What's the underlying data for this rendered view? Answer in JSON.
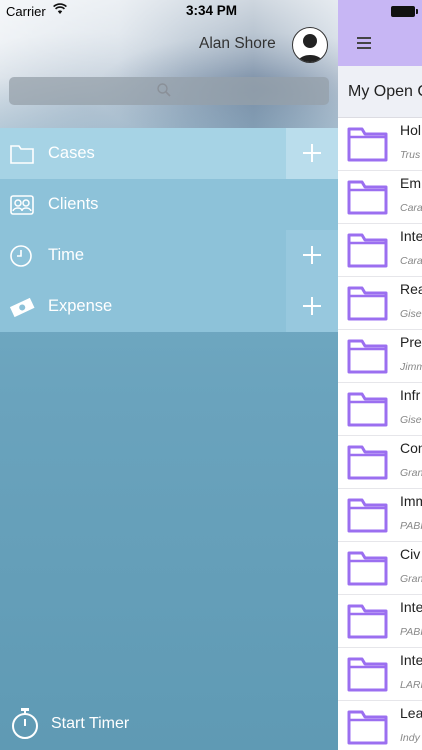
{
  "status_bar": {
    "carrier": "Carrier",
    "time": "3:34 PM"
  },
  "user": {
    "name": "Alan Shore"
  },
  "search": {
    "placeholder": ""
  },
  "menu": {
    "items": [
      {
        "label": "Cases",
        "icon": "folder-icon",
        "has_add": true,
        "active": true
      },
      {
        "label": "Clients",
        "icon": "contacts-icon",
        "has_add": false
      },
      {
        "label": "Time",
        "icon": "clock-icon",
        "has_add": true
      },
      {
        "label": "Expense",
        "icon": "money-icon",
        "has_add": true
      }
    ]
  },
  "footer": {
    "start_timer_label": "Start Timer"
  },
  "main": {
    "section_title": "My Open C",
    "cases": [
      {
        "title": "Hol",
        "sub": "Trus"
      },
      {
        "title": "Em",
        "sub": "Cara"
      },
      {
        "title": "Inte",
        "sub": "Cara"
      },
      {
        "title": "Rea",
        "sub": "Gise"
      },
      {
        "title": "Pre",
        "sub": "Jimm"
      },
      {
        "title": "Infr",
        "sub": "Gise"
      },
      {
        "title": "Con",
        "sub": "Gran"
      },
      {
        "title": "Imm",
        "sub": "PABI"
      },
      {
        "title": "Civ",
        "sub": "Gran"
      },
      {
        "title": "Inte",
        "sub": "PABI"
      },
      {
        "title": "Inte",
        "sub": "LARI"
      },
      {
        "title": "Lea",
        "sub": "Indy"
      }
    ]
  },
  "colors": {
    "accent_purple": "#c7b6f4",
    "folder_purple": "#9b6ff0",
    "drawer_blue": "#6aa3bd",
    "menu_active": "#a6d3e5"
  }
}
